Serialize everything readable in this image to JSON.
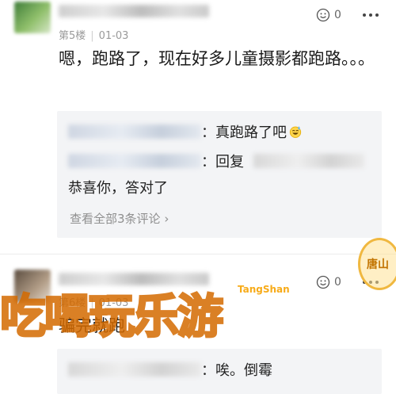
{
  "post1": {
    "floor": "第5楼",
    "date": "01-03",
    "like_count": "0",
    "content": "嗯，跑路了，现在好多儿童摄影都跑路。。。",
    "replies": [
      {
        "text": "：真跑路了吧"
      },
      {
        "text": "：回复"
      },
      {
        "text": "恭喜你，答对了"
      }
    ],
    "view_all": "查看全部3条评论"
  },
  "post2": {
    "floor": "第6楼",
    "date": "01-03",
    "like_count": "0",
    "content": "骗完就跑",
    "replies": [
      {
        "text": "：唉。倒霉"
      }
    ]
  },
  "watermark": {
    "main_text": "吃喝玩乐游",
    "en_text": "TangShan",
    "seal_text": "唐山"
  },
  "icons": {
    "like": "thumbs-up-smile-icon",
    "more": "more-dots-icon",
    "emoji": "sweat-smile-emoji-icon",
    "chevron": "chevron-right-icon"
  }
}
